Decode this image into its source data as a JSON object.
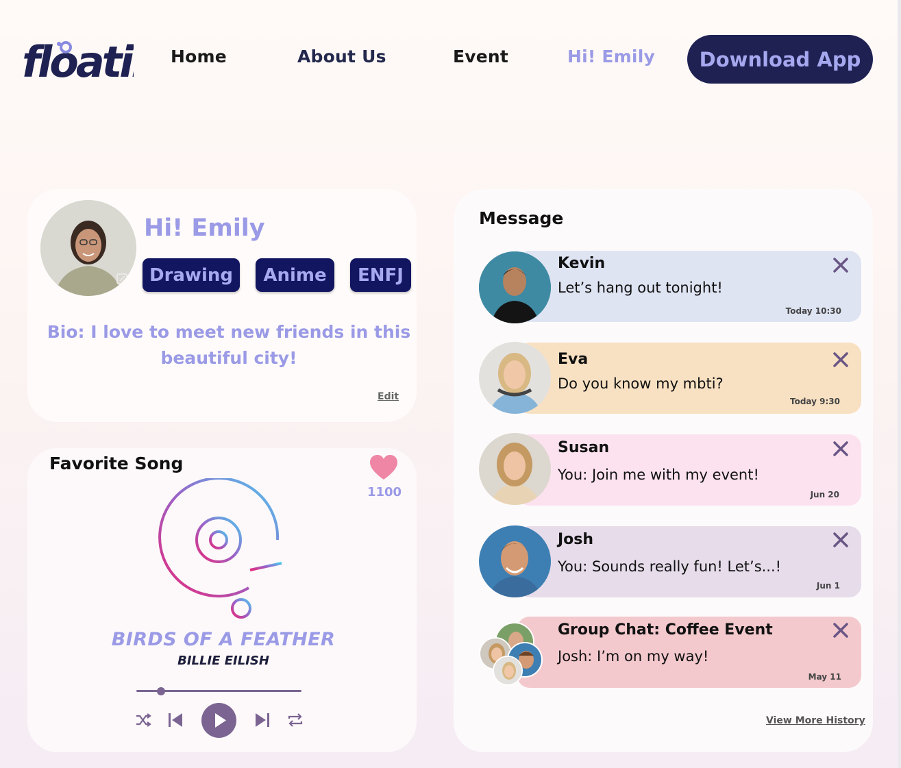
{
  "nav": {
    "logo_text": "floatin",
    "home": "Home",
    "about": "About Us",
    "event": "Event",
    "greeting": "Hi! Emily",
    "download": "Download App"
  },
  "profile": {
    "greeting": "Hi! Emily",
    "tags": [
      "Drawing",
      "Anime",
      "ENFJ"
    ],
    "bio": "Bio: I love to meet new friends in this beautiful city!",
    "edit": "Edit"
  },
  "song": {
    "header": "Favorite Song",
    "likes": "1100",
    "title": "BIRDS OF A FEATHER",
    "artist": "BILLIE EILISH",
    "progress": 0.15
  },
  "messages": {
    "header": "Message",
    "items": [
      {
        "name": "Kevin",
        "text": "Let’s hang out tonight!",
        "time": "Today 10:30",
        "color": "#dfe4f3"
      },
      {
        "name": "Eva",
        "text": "Do you know my mbti?",
        "time": "Today 9:30",
        "color": "#f8e1c2"
      },
      {
        "name": "Susan",
        "text": "You: Join me with my event!",
        "time": "Jun 20",
        "color": "#fce2ef"
      },
      {
        "name": "Josh",
        "text": "You: Sounds really fun! Let’s...!",
        "time": "Jun 1",
        "color": "#e6dcea"
      },
      {
        "name": "Group Chat: Coffee Event",
        "text": "Josh: I’m on my way!",
        "time": "May 11",
        "color": "#f3c9cd"
      }
    ],
    "view_more": "View More History"
  },
  "colors": {
    "accent": "#9a9ae6",
    "navy": "#1e2152",
    "tag_bg": "#121560",
    "player": "#7b6491",
    "close": "#6a5685"
  }
}
